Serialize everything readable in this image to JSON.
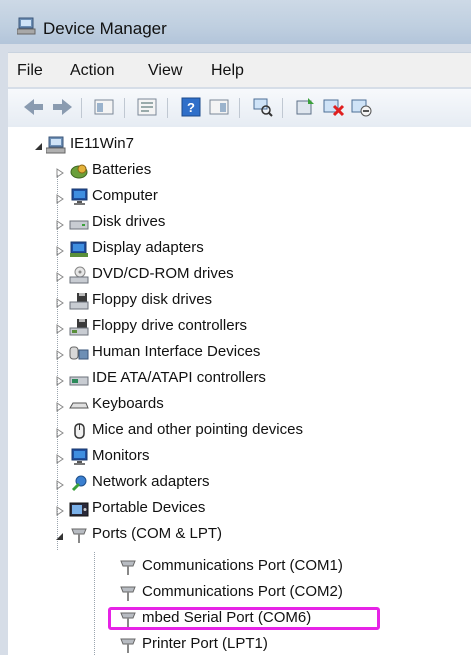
{
  "window": {
    "title": "Device Manager",
    "icon": "device-manager-icon"
  },
  "menu": [
    "File",
    "Action",
    "View",
    "Help"
  ],
  "toolbar": {
    "buttons": [
      "back-arrow-icon",
      "forward-arrow-icon",
      "show-hide-tree-icon",
      "properties-icon",
      "help-icon",
      "view-icon",
      "scan-hardware-icon",
      "update-driver-icon",
      "uninstall-device-icon",
      "disable-device-icon"
    ]
  },
  "tree": {
    "root": {
      "label": "IE11Win7",
      "icon": "computer-icon"
    },
    "categories": [
      {
        "label": "Batteries",
        "icon": "battery-icon"
      },
      {
        "label": "Computer",
        "icon": "monitor-icon"
      },
      {
        "label": "Disk drives",
        "icon": "disk-drive-icon"
      },
      {
        "label": "Display adapters",
        "icon": "display-adapter-icon"
      },
      {
        "label": "DVD/CD-ROM drives",
        "icon": "dvd-drive-icon"
      },
      {
        "label": "Floppy disk drives",
        "icon": "floppy-disk-icon"
      },
      {
        "label": "Floppy drive controllers",
        "icon": "floppy-controller-icon"
      },
      {
        "label": "Human Interface Devices",
        "icon": "hid-icon"
      },
      {
        "label": "IDE ATA/ATAPI controllers",
        "icon": "ide-controller-icon"
      },
      {
        "label": "Keyboards",
        "icon": "keyboard-icon"
      },
      {
        "label": "Mice and other pointing devices",
        "icon": "mouse-icon"
      },
      {
        "label": "Monitors",
        "icon": "monitor-icon"
      },
      {
        "label": "Network adapters",
        "icon": "network-adapter-icon"
      },
      {
        "label": "Portable Devices",
        "icon": "portable-device-icon"
      },
      {
        "label": "Ports (COM & LPT)",
        "icon": "port-icon"
      }
    ],
    "ports": [
      {
        "label": "Communications Port (COM1)",
        "icon": "port-icon"
      },
      {
        "label": "Communications Port (COM2)",
        "icon": "port-icon"
      },
      {
        "label": "mbed Serial Port (COM6)",
        "icon": "port-icon"
      },
      {
        "label": "Printer Port (LPT1)",
        "icon": "port-icon"
      }
    ]
  },
  "colors": {
    "highlight": "#e623e6",
    "titlebar": "#bfcfe0"
  }
}
